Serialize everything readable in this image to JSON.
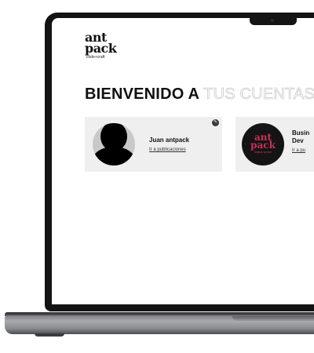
{
  "logo": {
    "line1": "ant",
    "line2": "pack",
    "tagline": "code+craft"
  },
  "heading": {
    "part1": "BIENVENIDO A",
    "part2": "TUS CUENTAS"
  },
  "accounts": [
    {
      "name": "Juan antpack",
      "link": "Ir a publicaciones",
      "edit_icon": "pencil-icon",
      "avatar": "person-silhouette"
    },
    {
      "name_line1": "Busin",
      "name_line2": "Dev",
      "link": "Ir a pu",
      "avatar_text1": "ant",
      "avatar_text2": "pack",
      "avatar_subtext": "digital sense"
    }
  ],
  "colors": {
    "bezel": "#141414",
    "card_bg": "#efeff0",
    "brand_accent": "#c9305a",
    "heading_outline": "#b9b9b9"
  }
}
